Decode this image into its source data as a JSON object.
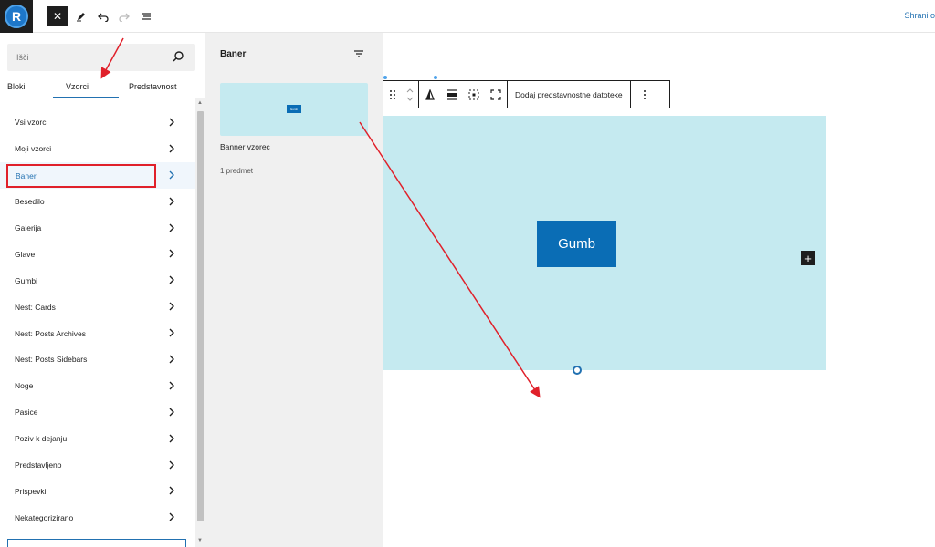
{
  "topbar": {
    "logo_letter": "R",
    "close_icon": "close-icon",
    "tool_icon": "pencil-icon",
    "undo_icon": "undo-icon",
    "redo_icon": "redo-icon",
    "outline_icon": "list-view-icon",
    "save_label": "Shrani o"
  },
  "inserter": {
    "search_placeholder": "Išči",
    "tabs": [
      {
        "label": "Bloki"
      },
      {
        "label": "Vzorci",
        "active": true
      },
      {
        "label": "Predstavnost"
      }
    ],
    "categories": [
      {
        "label": "Vsi vzorci"
      },
      {
        "label": "Moji vzorci"
      },
      {
        "label": "Baner",
        "active": true
      },
      {
        "label": "Besedilo"
      },
      {
        "label": "Galerija"
      },
      {
        "label": "Glave"
      },
      {
        "label": "Gumbi"
      },
      {
        "label": "Nest: Cards"
      },
      {
        "label": "Nest: Posts Archives"
      },
      {
        "label": "Nest: Posts Sidebars"
      },
      {
        "label": "Noge"
      },
      {
        "label": "Pasice"
      },
      {
        "label": "Poziv k dejanju"
      },
      {
        "label": "Predstavljeno"
      },
      {
        "label": "Prispevki"
      },
      {
        "label": "Nekategorizirano"
      }
    ]
  },
  "pattern_panel": {
    "title": "Baner",
    "filter_icon": "filter-icon",
    "pattern_name": "Banner vzorec",
    "preview_button": "Gumb",
    "count_label": "1 predmet"
  },
  "block_toolbar": {
    "media_label": "Dodaj predstavnostne datoteke"
  },
  "canvas": {
    "button_label": "Gumb",
    "add_block": "+"
  },
  "colors": {
    "banner_bg": "#c5eaf0",
    "button_bg": "#0a6db5",
    "accent": "#2271b1",
    "annotation_red": "#e0202a"
  }
}
